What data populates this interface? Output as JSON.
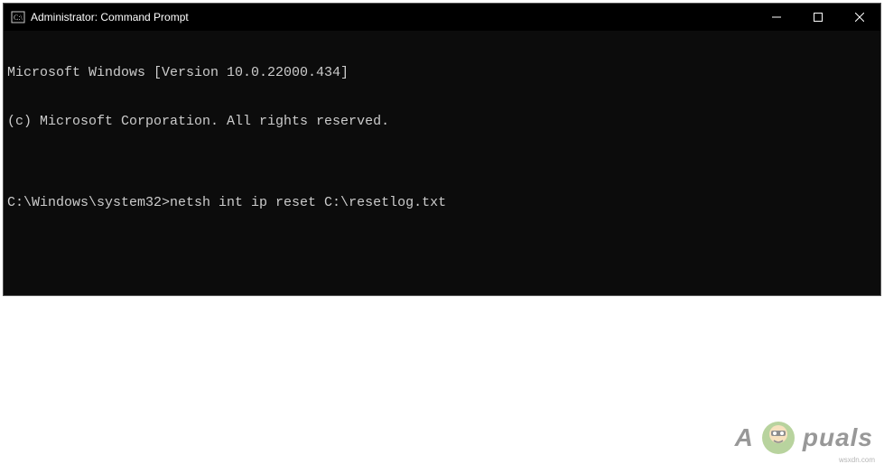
{
  "window": {
    "title": "Administrator: Command Prompt"
  },
  "terminal": {
    "line1": "Microsoft Windows [Version 10.0.22000.434]",
    "line2": "(c) Microsoft Corporation. All rights reserved.",
    "blank": "",
    "prompt": "C:\\Windows\\system32>",
    "command": "netsh int ip reset C:\\resetlog.txt"
  },
  "watermark": {
    "text_left": "A",
    "text_right": "puals"
  },
  "credit": "wsxdn.com"
}
